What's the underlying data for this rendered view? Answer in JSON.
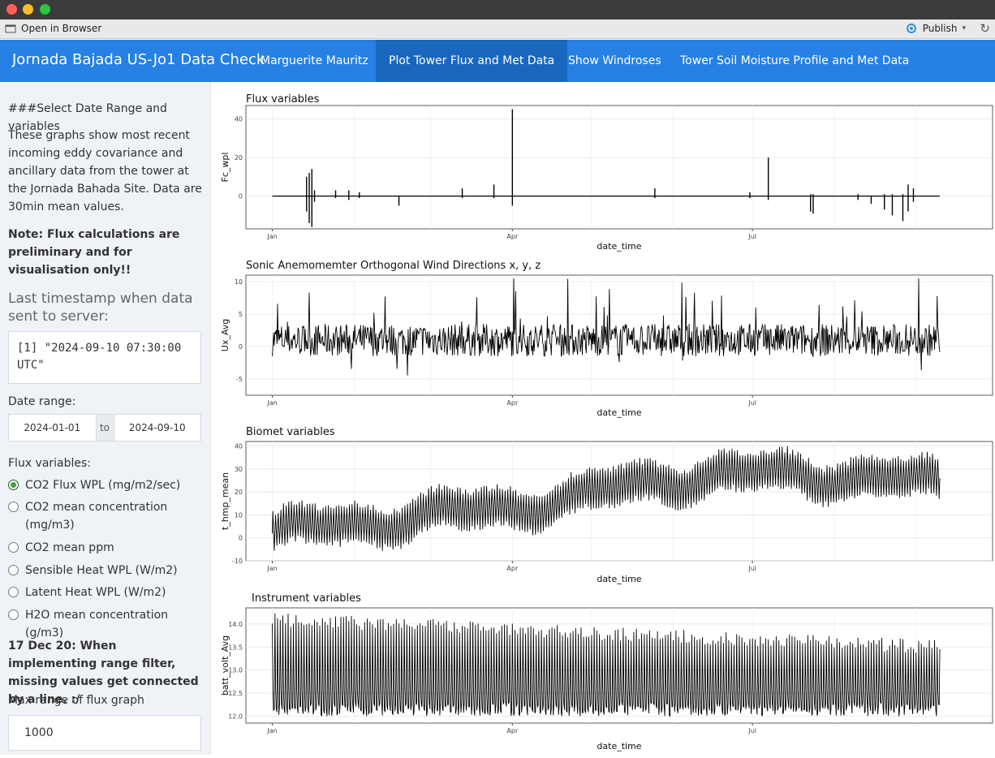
{
  "window": {
    "colors": {
      "close": "#fe5f57",
      "minimize": "#febc2e",
      "maximize": "#28c840"
    }
  },
  "toolbar": {
    "open_in_browser": "Open in Browser",
    "publish": "Publish"
  },
  "navbar": {
    "brand": "Jornada Bajada US-Jo1 Data Check",
    "tabs": [
      {
        "label": "Marguerite Mauritz",
        "active": false
      },
      {
        "label": "Plot Tower Flux and Met Data",
        "active": true
      },
      {
        "label": "Show Windroses",
        "active": false
      },
      {
        "label": "Tower Soil Moisture Profile and Met Data",
        "active": false
      }
    ],
    "color": "#2780e3"
  },
  "sidebar": {
    "heading": "###Select Date Range and variables",
    "intro": "These graphs show most recent incoming eddy covariance and ancillary data from the tower at the Jornada Bahada Site. Data are 30min mean values.",
    "note": "Note: Flux calculations are preliminary and for visualisation only!!",
    "last_ts_title": "Last timestamp when data sent to server:",
    "last_ts_value": "[1] \"2024-09-10 07:30:00 UTC\"",
    "date_range_label": "Date range:",
    "date_start": "2024-01-01",
    "date_to": "to",
    "date_end": "2024-09-10",
    "flux_label": "Flux variables:",
    "flux_options": [
      {
        "label": "CO2 Flux WPL (mg/m2/sec)",
        "selected": true
      },
      {
        "label": "CO2 mean concentration (mg/m3)",
        "selected": false
      },
      {
        "label": "CO2 mean ppm",
        "selected": false
      },
      {
        "label": "Sensible Heat WPL (W/m2)",
        "selected": false
      },
      {
        "label": "Latent Heat WPL (W/m2)",
        "selected": false
      },
      {
        "label": "H2O mean concentration (g/m3)",
        "selected": false
      }
    ],
    "dec_note": "17 Dec 20: When implementing range filter, missing values get connected by a line. :/",
    "max_range_label": "Max range of flux graph",
    "max_range_value": "1000"
  },
  "chart_data": [
    {
      "type": "line",
      "title": "Flux variables",
      "xlabel": "date_time",
      "ylabel": "Fc_wpl",
      "x_ticks": [
        "Jan",
        "Apr",
        "Jul"
      ],
      "y_ticks": [
        0,
        20,
        40
      ],
      "ylim": [
        -17,
        47
      ],
      "xlim": [
        "2024-01-01",
        "2024-09-10"
      ],
      "baseline": 0,
      "spikes": [
        {
          "x": "2024-01-14",
          "low": -8,
          "high": 10
        },
        {
          "x": "2024-01-15",
          "low": -14,
          "high": 12
        },
        {
          "x": "2024-01-16",
          "low": -16,
          "high": 14
        },
        {
          "x": "2024-01-17",
          "low": -3,
          "high": 3
        },
        {
          "x": "2024-01-25",
          "low": -1,
          "high": 3
        },
        {
          "x": "2024-01-30",
          "low": -2,
          "high": 3
        },
        {
          "x": "2024-02-03",
          "low": -1,
          "high": 2
        },
        {
          "x": "2024-02-18",
          "low": -5,
          "high": 0
        },
        {
          "x": "2024-03-13",
          "low": -1,
          "high": 4
        },
        {
          "x": "2024-03-25",
          "low": -1,
          "high": 6
        },
        {
          "x": "2024-04-01",
          "low": -5,
          "high": 45
        },
        {
          "x": "2024-05-25",
          "low": -1,
          "high": 4
        },
        {
          "x": "2024-06-30",
          "low": -1,
          "high": 2
        },
        {
          "x": "2024-07-07",
          "low": -2,
          "high": 20
        },
        {
          "x": "2024-07-23",
          "low": -8,
          "high": 1
        },
        {
          "x": "2024-07-24",
          "low": -9,
          "high": 1
        },
        {
          "x": "2024-08-10",
          "low": -2,
          "high": 1
        },
        {
          "x": "2024-08-15",
          "low": -4,
          "high": 0
        },
        {
          "x": "2024-08-20",
          "low": -7,
          "high": 1
        },
        {
          "x": "2024-08-23",
          "low": -10,
          "high": 1
        },
        {
          "x": "2024-08-27",
          "low": -13,
          "high": 1
        },
        {
          "x": "2024-08-29",
          "low": -8,
          "high": 6
        },
        {
          "x": "2024-08-31",
          "low": -3,
          "high": 4
        }
      ]
    },
    {
      "type": "line",
      "title": "Sonic Anemomemter Orthogonal Wind Directions x, y, z",
      "xlabel": "date_time",
      "ylabel": "Ux_Avg",
      "x_ticks": [
        "Jan",
        "Apr",
        "Jul"
      ],
      "y_ticks": [
        -5,
        0,
        5,
        10
      ],
      "ylim": [
        -7.5,
        11
      ],
      "xlim": [
        "2024-01-01",
        "2024-09-10"
      ],
      "mean": 1,
      "range": [
        -6.5,
        10.5
      ]
    },
    {
      "type": "line",
      "title": "Biomet variables",
      "xlabel": "date_time",
      "ylabel": "t_hmp_mean",
      "x_ticks": [
        "Jan",
        "Apr",
        "Jul"
      ],
      "y_ticks": [
        -10,
        0,
        10,
        20,
        30,
        40
      ],
      "ylim": [
        -10,
        42
      ],
      "xlim": [
        "2024-01-01",
        "2024-09-10"
      ],
      "monthly_mean": [
        {
          "x": "2024-01-01",
          "y": 2
        },
        {
          "x": "2024-02-01",
          "y": 6
        },
        {
          "x": "2024-03-01",
          "y": 10
        },
        {
          "x": "2024-04-01",
          "y": 13
        },
        {
          "x": "2024-05-01",
          "y": 19
        },
        {
          "x": "2024-06-01",
          "y": 26
        },
        {
          "x": "2024-07-01",
          "y": 28
        },
        {
          "x": "2024-08-01",
          "y": 27
        },
        {
          "x": "2024-09-10",
          "y": 24
        }
      ],
      "daily_amplitude": 8
    },
    {
      "type": "line",
      "title": "Instrument variables",
      "xlabel": "date_time",
      "ylabel": "batt_volt_Avg",
      "x_ticks": [
        "Jan",
        "Apr",
        "Jul"
      ],
      "y_ticks": [
        12.0,
        12.5,
        13.0,
        13.5,
        14.0
      ],
      "ylim": [
        11.85,
        14.35
      ],
      "xlim": [
        "2024-01-01",
        "2024-09-10"
      ],
      "low": 12.0,
      "high_start": 14.1,
      "high_end": 13.5
    }
  ]
}
